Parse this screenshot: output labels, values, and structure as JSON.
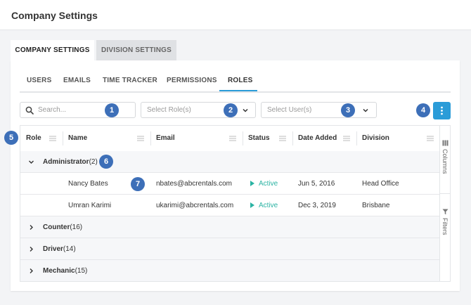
{
  "page": {
    "title": "Company Settings"
  },
  "top_tabs": [
    {
      "label": "COMPANY SETTINGS",
      "active": true
    },
    {
      "label": "DIVISION SETTINGS",
      "active": false
    }
  ],
  "sub_tabs": [
    {
      "label": "USERS"
    },
    {
      "label": "EMAILS"
    },
    {
      "label": "TIME TRACKER"
    },
    {
      "label": "PERMISSIONS"
    },
    {
      "label": "ROLES",
      "active": true
    }
  ],
  "filters": {
    "search_placeholder": "Search...",
    "roles_placeholder": "Select Role(s)",
    "users_placeholder": "Select User(s)"
  },
  "badges": [
    "1",
    "2",
    "3",
    "4",
    "5",
    "6",
    "7"
  ],
  "grid": {
    "columns": [
      "Role",
      "Name",
      "Email",
      "Status",
      "Date Added",
      "Division"
    ],
    "groups": [
      {
        "name": "Administrator",
        "count": "(2)",
        "expanded": true,
        "rows": [
          {
            "name": "Nancy Bates",
            "email": "nbates@abcrentals.com",
            "status": "Active",
            "date_added": "Jun 5, 2016",
            "division": "Head Office"
          },
          {
            "name": "Umran Karimi",
            "email": "ukarimi@abcrentals.com",
            "status": "Active",
            "date_added": "Dec 3, 2019",
            "division": "Brisbane"
          }
        ]
      },
      {
        "name": "Counter",
        "count": "(16)",
        "expanded": false
      },
      {
        "name": "Driver",
        "count": "(14)",
        "expanded": false
      },
      {
        "name": "Mechanic",
        "count": "(15)",
        "expanded": false
      }
    ],
    "side_panel": {
      "columns_label": "Columns",
      "filters_label": "Filters"
    }
  },
  "colors": {
    "accent": "#2b9cd8",
    "badge": "#3d6fb8",
    "active_status": "#2bb3a3"
  },
  "icons": [
    "search-icon",
    "chevron-down-icon",
    "more-vertical-icon",
    "column-menu-icon",
    "chevron-right-icon",
    "play-icon",
    "columns-icon",
    "filter-icon"
  ]
}
